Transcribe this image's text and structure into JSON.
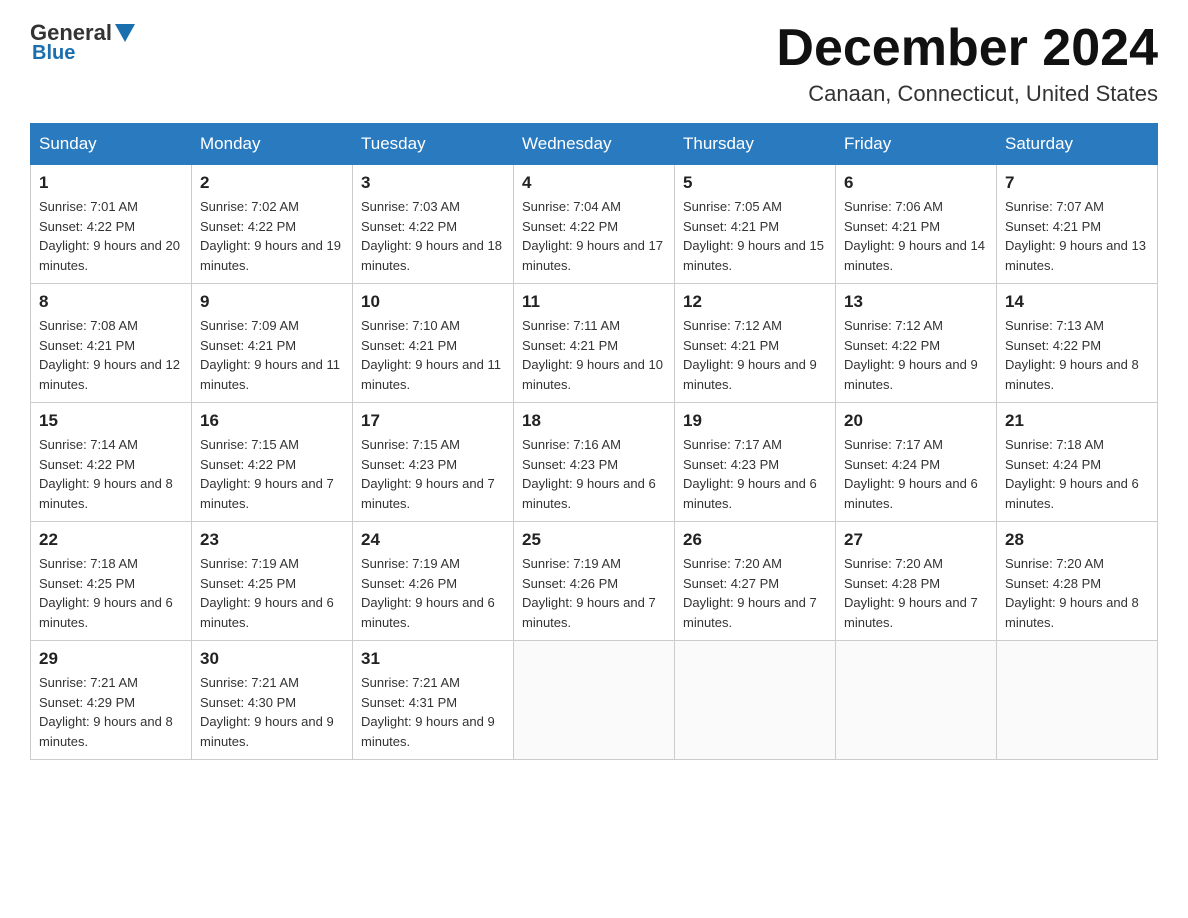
{
  "header": {
    "logo_general": "General",
    "logo_blue": "Blue",
    "month_title": "December 2024",
    "location": "Canaan, Connecticut, United States"
  },
  "days_of_week": [
    "Sunday",
    "Monday",
    "Tuesday",
    "Wednesday",
    "Thursday",
    "Friday",
    "Saturday"
  ],
  "weeks": [
    [
      {
        "num": "1",
        "sunrise": "7:01 AM",
        "sunset": "4:22 PM",
        "daylight": "9 hours and 20 minutes."
      },
      {
        "num": "2",
        "sunrise": "7:02 AM",
        "sunset": "4:22 PM",
        "daylight": "9 hours and 19 minutes."
      },
      {
        "num": "3",
        "sunrise": "7:03 AM",
        "sunset": "4:22 PM",
        "daylight": "9 hours and 18 minutes."
      },
      {
        "num": "4",
        "sunrise": "7:04 AM",
        "sunset": "4:22 PM",
        "daylight": "9 hours and 17 minutes."
      },
      {
        "num": "5",
        "sunrise": "7:05 AM",
        "sunset": "4:21 PM",
        "daylight": "9 hours and 15 minutes."
      },
      {
        "num": "6",
        "sunrise": "7:06 AM",
        "sunset": "4:21 PM",
        "daylight": "9 hours and 14 minutes."
      },
      {
        "num": "7",
        "sunrise": "7:07 AM",
        "sunset": "4:21 PM",
        "daylight": "9 hours and 13 minutes."
      }
    ],
    [
      {
        "num": "8",
        "sunrise": "7:08 AM",
        "sunset": "4:21 PM",
        "daylight": "9 hours and 12 minutes."
      },
      {
        "num": "9",
        "sunrise": "7:09 AM",
        "sunset": "4:21 PM",
        "daylight": "9 hours and 11 minutes."
      },
      {
        "num": "10",
        "sunrise": "7:10 AM",
        "sunset": "4:21 PM",
        "daylight": "9 hours and 11 minutes."
      },
      {
        "num": "11",
        "sunrise": "7:11 AM",
        "sunset": "4:21 PM",
        "daylight": "9 hours and 10 minutes."
      },
      {
        "num": "12",
        "sunrise": "7:12 AM",
        "sunset": "4:21 PM",
        "daylight": "9 hours and 9 minutes."
      },
      {
        "num": "13",
        "sunrise": "7:12 AM",
        "sunset": "4:22 PM",
        "daylight": "9 hours and 9 minutes."
      },
      {
        "num": "14",
        "sunrise": "7:13 AM",
        "sunset": "4:22 PM",
        "daylight": "9 hours and 8 minutes."
      }
    ],
    [
      {
        "num": "15",
        "sunrise": "7:14 AM",
        "sunset": "4:22 PM",
        "daylight": "9 hours and 8 minutes."
      },
      {
        "num": "16",
        "sunrise": "7:15 AM",
        "sunset": "4:22 PM",
        "daylight": "9 hours and 7 minutes."
      },
      {
        "num": "17",
        "sunrise": "7:15 AM",
        "sunset": "4:23 PM",
        "daylight": "9 hours and 7 minutes."
      },
      {
        "num": "18",
        "sunrise": "7:16 AM",
        "sunset": "4:23 PM",
        "daylight": "9 hours and 6 minutes."
      },
      {
        "num": "19",
        "sunrise": "7:17 AM",
        "sunset": "4:23 PM",
        "daylight": "9 hours and 6 minutes."
      },
      {
        "num": "20",
        "sunrise": "7:17 AM",
        "sunset": "4:24 PM",
        "daylight": "9 hours and 6 minutes."
      },
      {
        "num": "21",
        "sunrise": "7:18 AM",
        "sunset": "4:24 PM",
        "daylight": "9 hours and 6 minutes."
      }
    ],
    [
      {
        "num": "22",
        "sunrise": "7:18 AM",
        "sunset": "4:25 PM",
        "daylight": "9 hours and 6 minutes."
      },
      {
        "num": "23",
        "sunrise": "7:19 AM",
        "sunset": "4:25 PM",
        "daylight": "9 hours and 6 minutes."
      },
      {
        "num": "24",
        "sunrise": "7:19 AM",
        "sunset": "4:26 PM",
        "daylight": "9 hours and 6 minutes."
      },
      {
        "num": "25",
        "sunrise": "7:19 AM",
        "sunset": "4:26 PM",
        "daylight": "9 hours and 7 minutes."
      },
      {
        "num": "26",
        "sunrise": "7:20 AM",
        "sunset": "4:27 PM",
        "daylight": "9 hours and 7 minutes."
      },
      {
        "num": "27",
        "sunrise": "7:20 AM",
        "sunset": "4:28 PM",
        "daylight": "9 hours and 7 minutes."
      },
      {
        "num": "28",
        "sunrise": "7:20 AM",
        "sunset": "4:28 PM",
        "daylight": "9 hours and 8 minutes."
      }
    ],
    [
      {
        "num": "29",
        "sunrise": "7:21 AM",
        "sunset": "4:29 PM",
        "daylight": "9 hours and 8 minutes."
      },
      {
        "num": "30",
        "sunrise": "7:21 AM",
        "sunset": "4:30 PM",
        "daylight": "9 hours and 9 minutes."
      },
      {
        "num": "31",
        "sunrise": "7:21 AM",
        "sunset": "4:31 PM",
        "daylight": "9 hours and 9 minutes."
      },
      null,
      null,
      null,
      null
    ]
  ]
}
